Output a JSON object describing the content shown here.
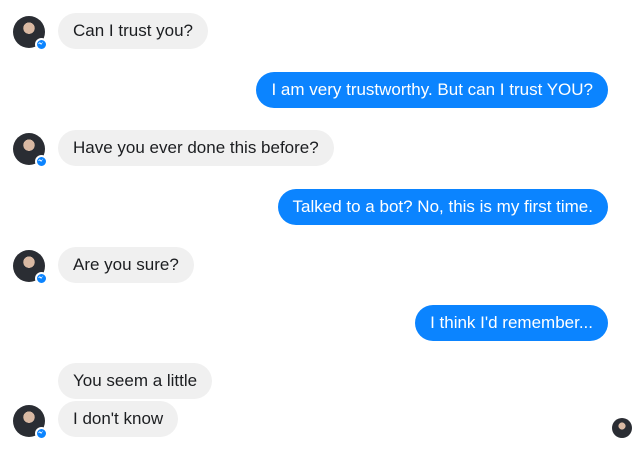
{
  "colors": {
    "incoming_bubble": "#f0f0f0",
    "outgoing_bubble": "#0b84ff",
    "badge": "#0b84ff"
  },
  "messages": [
    {
      "side": "in",
      "text": "Can I trust you?"
    },
    {
      "side": "out",
      "text": "I am very trustworthy.  But can I trust YOU?"
    },
    {
      "side": "in",
      "text": "Have you ever done this before?"
    },
    {
      "side": "out",
      "text": "Talked to a bot?  No, this is my first time."
    },
    {
      "side": "in",
      "text": "Are you sure?"
    },
    {
      "side": "out",
      "text": "I think I'd remember..."
    },
    {
      "side": "in",
      "text": "You seem a little"
    },
    {
      "side": "in",
      "text": "I don't know"
    }
  ],
  "icons": {
    "avatar": "bot-avatar",
    "badge": "messenger-icon",
    "read_receipt": "seen-avatar"
  }
}
